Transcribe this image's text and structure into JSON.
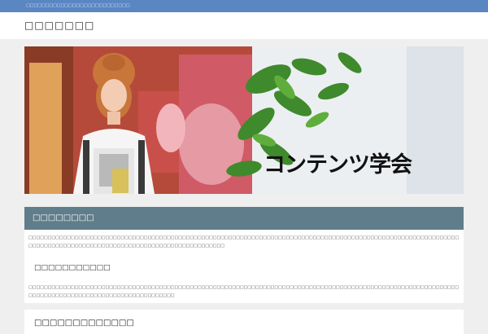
{
  "topbar": {
    "tagline": "□□□□□□□□□□□□□□□□□□□□□□□□□□□"
  },
  "header": {
    "site_title": "□□□□□□□"
  },
  "hero": {
    "caption": "コンテンツ学会"
  },
  "section": {
    "title": "□□□□□□□□",
    "paragraph1": "□□□□□□□□□□□□□□□□□□□□□□□□□□□□□□□□□□□□□□□□□□□□□□□□□□□□□□□□□□□□□□□□□□□□□□□□□□□□□□□□□□□□□□□□□□□□□□□□□□□□□□□□□□□□□□□□□□□□□□□□□□□□□□□□□□□□□□□□□□□□□□□□□□□□□□□□□□□□□□□□□□□",
    "subheading": "□□□□□□□□□□□",
    "paragraph2": "□□□□□□□□□□□□□□□□□□□□□□□□□□□□□□□□□□□□□□□□□□□□□□□□□□□□□□□□□□□□□□□□□□□□□□□□□□□□□□□□□□□□□□□□□□□□□□□□□□□□□□□□□□□□□□□□□□□□□□□□□□□□□□□□□□□□□□□□□□□□□□□□□□□□□□"
  },
  "section2": {
    "title": "□□□□□□□□□□□□□"
  }
}
